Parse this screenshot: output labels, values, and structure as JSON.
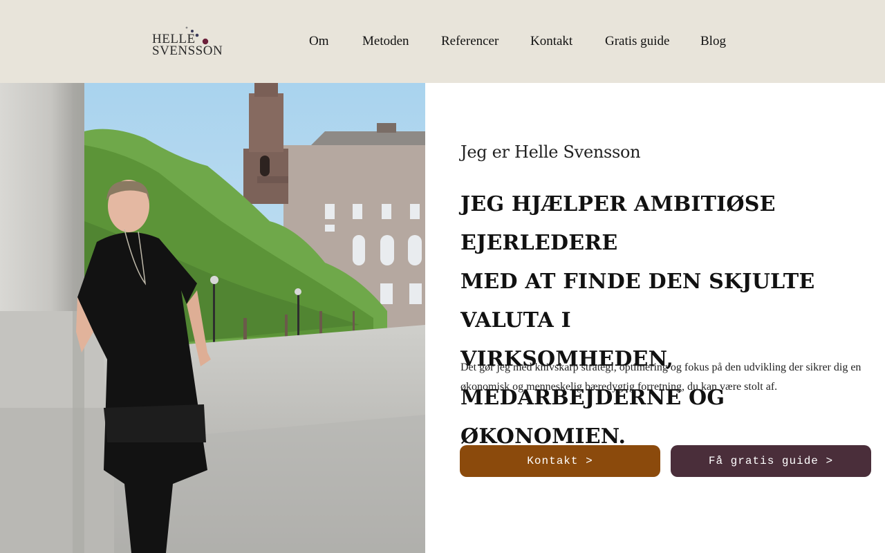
{
  "logo": {
    "line1": "HELLE",
    "line2": "SVENSSON"
  },
  "nav": {
    "items": [
      "Om",
      "Metoden",
      "Referencer",
      "Kontakt",
      "Gratis guide",
      "Blog"
    ]
  },
  "hero": {
    "intro": "Jeg er Helle Svensson",
    "headline_lines": [
      "JEG HJÆLPER AMBITIØSE EJERLEDERE",
      "MED AT FINDE DEN SKJULTE VALUTA I",
      "VIRKSOMHEDEN, MEDARBEJDERNE OG",
      "ØKONOMIEN."
    ],
    "description_lines": [
      "Det gør jeg med knivskarp strategi, optimering og fokus på den udvikling der sikrer dig en",
      "økonomisk og menneskelig bæredygtig forretning, du kan være stolt af."
    ],
    "contact_button": "Kontakt >",
    "guide_button": "Få gratis guide >"
  },
  "colors": {
    "header_bg": "#e8e4da",
    "contact_button": "#8b4a0c",
    "guide_button": "#4a2e3a",
    "logo_dot": "#6b1f3a"
  }
}
